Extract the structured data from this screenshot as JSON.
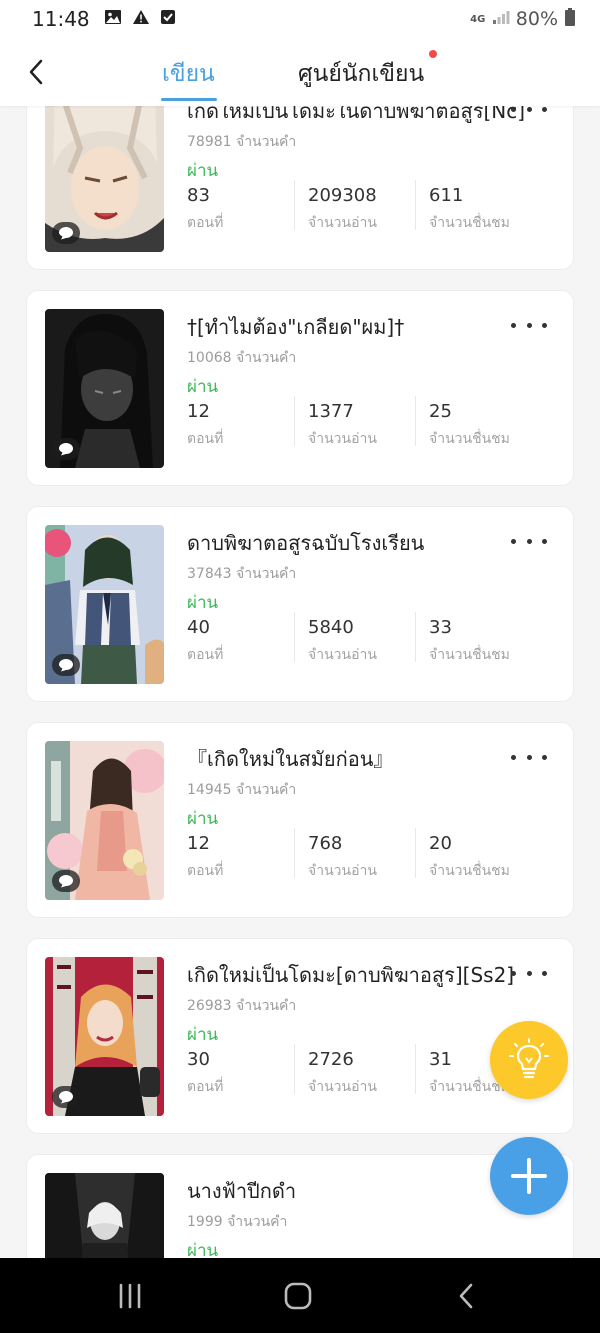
{
  "status_bar": {
    "time": "11:48",
    "network": "4G",
    "battery": "80%"
  },
  "header": {
    "tabs": [
      {
        "label": "เขียน",
        "active": true
      },
      {
        "label": "ศูนย์นักเขียน",
        "active": false,
        "has_notification": true
      }
    ]
  },
  "stat_labels": {
    "chapters": "ตอนที่",
    "reads": "จำนวนอ่าน",
    "likes": "จำนวนชื่นชม"
  },
  "works": [
    {
      "title": "เกิดใหม่เป็นโดมะในดาบพิฆาตอสูร[Nc]",
      "words": "78981 จำนวนคำ",
      "status": "ผ่าน",
      "chapters": "83",
      "reads": "209308",
      "likes": "611"
    },
    {
      "title": "†[ทำไมต้อง\"เกลียด\"ผม]†",
      "words": "10068 จำนวนคำ",
      "status": "ผ่าน",
      "chapters": "12",
      "reads": "1377",
      "likes": "25"
    },
    {
      "title": "ดาบพิฆาตอสูรฉบับโรงเรียน",
      "words": "37843 จำนวนคำ",
      "status": "ผ่าน",
      "chapters": "40",
      "reads": "5840",
      "likes": "33"
    },
    {
      "title": "『เกิดใหม่ในสมัยก่อน』",
      "words": "14945 จำนวนคำ",
      "status": "ผ่าน",
      "chapters": "12",
      "reads": "768",
      "likes": "20"
    },
    {
      "title": "เกิดใหม่เป็นโดมะ[ดาบพิฆาอสูร][Ss2]",
      "words": "26983 จำนวนคำ",
      "status": "ผ่าน",
      "chapters": "30",
      "reads": "2726",
      "likes": "31"
    },
    {
      "title": "นางฟ้าปีกดำ",
      "words": "1999 จำนวนคำ",
      "status": "ผ่าน",
      "chapters": "",
      "reads": "",
      "likes": ""
    }
  ],
  "colors": {
    "accent": "#4aa0dc",
    "status_passed": "#3cb955",
    "tips_fab": "#fdc82a",
    "add_fab": "#4aa0e6",
    "notification": "#f04b4b"
  },
  "icons": {
    "back": "chevron-left-icon",
    "comment": "comment-bubble-icon",
    "more": "more-dots-icon",
    "tips": "lightbulb-icon",
    "add": "plus-icon"
  }
}
